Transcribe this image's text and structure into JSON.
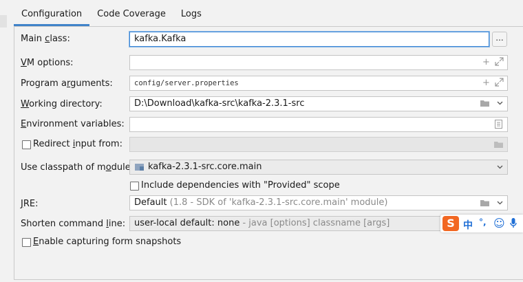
{
  "tabs": [
    "Configuration",
    "Code Coverage",
    "Logs"
  ],
  "form": {
    "main_class": {
      "label_pre": "Main ",
      "label_mn": "c",
      "label_post": "lass:",
      "value": "kafka.Kafka",
      "browse": "..."
    },
    "vm_options": {
      "label_mn": "V",
      "label_post": "M options:",
      "value": ""
    },
    "program_arguments": {
      "label_pre": "Program a",
      "label_mn": "r",
      "label_post": "guments:",
      "value": "config/server.properties"
    },
    "working_directory": {
      "label_mn": "W",
      "label_post": "orking directory:",
      "value": "D:\\Download\\kafka-src\\kafka-2.3.1-src"
    },
    "environment_variables": {
      "label_mn": "E",
      "label_post": "nvironment variables:",
      "value": ""
    },
    "redirect_input": {
      "label_pre": "Redirect ",
      "label_mn": "i",
      "label_post": "nput from:",
      "value": ""
    },
    "classpath_module": {
      "label_pre": "Use classpath of m",
      "label_mn": "o",
      "label_post": "dule:",
      "value": "kafka-2.3.1-src.core.main"
    },
    "include_provided": {
      "label": "Include dependencies with \"Provided\" scope"
    },
    "jre": {
      "label_mn": "J",
      "label_post": "RE:",
      "value_main": "Default",
      "value_hint": "(1.8 - SDK of 'kafka-2.3.1-src.core.main' module)"
    },
    "shorten_cmd": {
      "label_pre": "Shorten command ",
      "label_mn": "l",
      "label_post": "ine:",
      "value_main": "user-local default: none",
      "value_hint": " - java [options] classname [args]"
    },
    "capture_forms": {
      "label_mn": "E",
      "label_post": "nable capturing form snapshots"
    }
  },
  "ime": {
    "logo": "S",
    "mode_char": "中",
    "punct": "°,",
    "emoji": "☺",
    "mic": "mic-icon"
  },
  "colors": {
    "accent": "#4083c9",
    "focus": "#3d87d6",
    "ime_logo": "#f26722",
    "ime_icons": "#1f6fd6"
  }
}
